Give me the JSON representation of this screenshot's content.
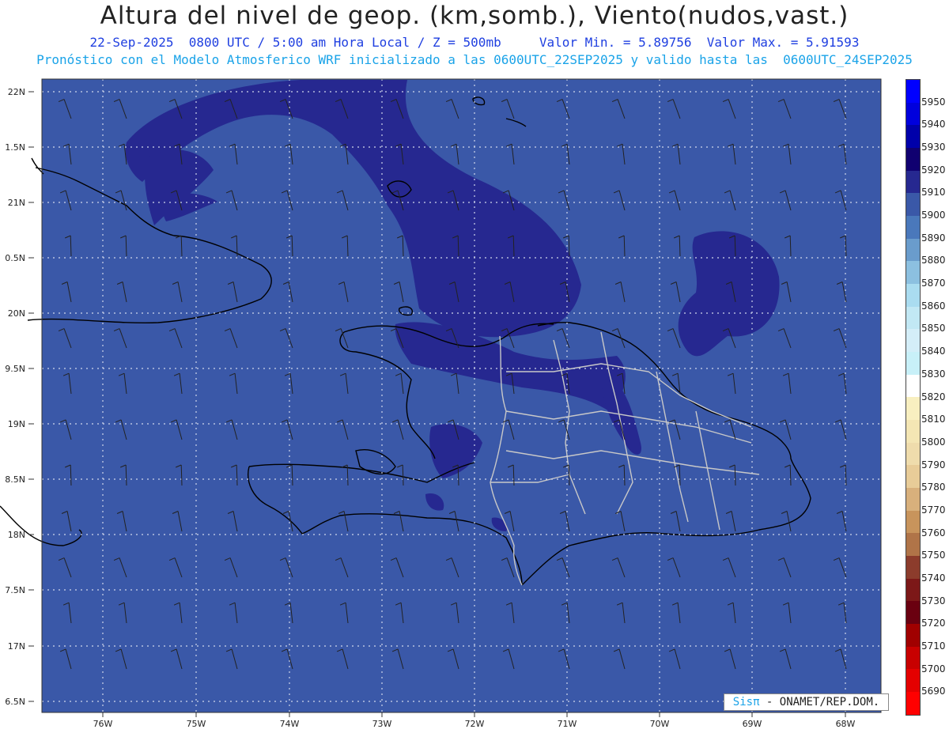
{
  "header": {
    "title": "Altura del nivel de geop. (km,somb.), Viento(nudos,vast.)",
    "line1": "22-Sep-2025  0800 UTC / 5:00 am Hora Local / Z = 500mb     Valor Min. = 5.89756  Valor Max. = 5.91593",
    "line2": "Pronóstico con el Modelo Atmosferico WRF inicializado a las 0600UTC_22SEP2025 y valido hasta las  0600UTC_24SEP2025"
  },
  "axes": {
    "lat_labels": [
      "22N",
      "1.5N",
      "21N",
      "0.5N",
      "20N",
      "9.5N",
      "19N",
      "8.5N",
      "18N",
      "7.5N",
      "17N",
      "6.5N"
    ],
    "lon_labels": [
      "76W",
      "75W",
      "74W",
      "73W",
      "72W",
      "71W",
      "70W",
      "69W",
      "68W"
    ]
  },
  "colorbar": {
    "levels": [
      "5950",
      "5940",
      "5930",
      "5920",
      "5910",
      "5900",
      "5890",
      "5880",
      "5870",
      "5860",
      "5850",
      "5840",
      "5830",
      "5820",
      "5810",
      "5800",
      "5790",
      "5780",
      "5770",
      "5760",
      "5750",
      "5740",
      "5730",
      "5720",
      "5710",
      "5700",
      "5690"
    ],
    "colors": [
      "#0000ff",
      "#0000dd",
      "#0000aa",
      "#100070",
      "#262890",
      "#3a58a8",
      "#4a78bb",
      "#6a9ccc",
      "#8cc0e0",
      "#aadcf0",
      "#c2e8f4",
      "#d4eef8",
      "#c8f0f8",
      "#ffffff",
      "#f8efc0",
      "#f4e6b4",
      "#efdcac",
      "#e8cc98",
      "#d8b07c",
      "#c8945c",
      "#b07448",
      "#8c3c2c",
      "#7c1818",
      "#6a0010",
      "#a00000",
      "#c80000",
      "#e40000",
      "#ff0000"
    ]
  },
  "map": {
    "background_color": "#3a58a8",
    "ridge_color": "#262890"
  },
  "credit": {
    "brand": "Sisπ",
    "text": " - ONAMET/REP.DOM."
  }
}
